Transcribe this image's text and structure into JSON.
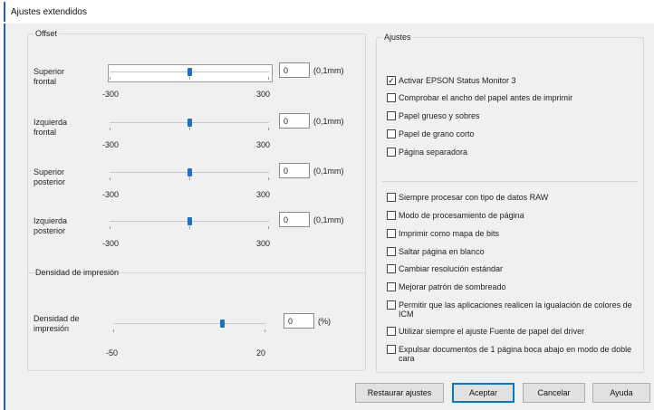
{
  "window": {
    "title": "Ajustes extendidos"
  },
  "offset": {
    "legend": "Offset",
    "sliders": [
      {
        "label_line1": "Superior",
        "label_line2": "frontal",
        "value": "0",
        "unit": "(0,1mm)",
        "min": "-300",
        "max": "300",
        "level": 0.5
      },
      {
        "label_line1": "Izquierda",
        "label_line2": "frontal",
        "value": "0",
        "unit": "(0,1mm)",
        "min": "-300",
        "max": "300",
        "level": 0.5
      },
      {
        "label_line1": "Superior",
        "label_line2": "posterior",
        "value": "0",
        "unit": "(0,1mm)",
        "min": "-300",
        "max": "300",
        "level": 0.5
      },
      {
        "label_line1": "Izquierda",
        "label_line2": "posterior",
        "value": "0",
        "unit": "(0,1mm)",
        "min": "-300",
        "max": "300",
        "level": 0.5
      }
    ]
  },
  "density": {
    "legend": "Densidad de impresión",
    "label_line1": "Densidad de",
    "label_line2": "impresión",
    "value": "0",
    "unit": "(%)",
    "min": "-50",
    "max": "20",
    "level": 0.714
  },
  "ajustes": {
    "legend": "Ajustes",
    "group1": [
      {
        "label": "Activar EPSON Status Monitor 3",
        "checked": true
      },
      {
        "label": "Comprobar el ancho del papel antes de imprimir",
        "checked": false
      },
      {
        "label": "Papel grueso y sobres",
        "checked": false
      },
      {
        "label": "Papel de grano corto",
        "checked": false
      },
      {
        "label": "Página separadora",
        "checked": false
      }
    ],
    "group2": [
      {
        "label": "Siempre procesar con tipo de datos RAW",
        "checked": false
      },
      {
        "label": "Modo de procesamiento de página",
        "checked": false
      },
      {
        "label": "Imprimir como mapa de bits",
        "checked": false
      },
      {
        "label": "Saltar página en blanco",
        "checked": false
      },
      {
        "label": "Cambiar resolución estándar",
        "checked": false
      },
      {
        "label": "Mejorar patrón de sombreado",
        "checked": false
      },
      {
        "label": "Permitir que las aplicaciones realicen la igualación de colores de ICM",
        "checked": false
      },
      {
        "label": "Utilizar siempre el ajuste Fuente de papel del driver",
        "checked": false
      },
      {
        "label": "Expulsar documentos de 1 página boca abajo en modo de doble cara",
        "checked": false
      }
    ]
  },
  "buttons": {
    "restore": "Restaurar ajustes",
    "ok": "Aceptar",
    "cancel": "Cancelar",
    "help": "Ayuda"
  },
  "colors": {
    "accent": "#1b6fd1",
    "frame": "#2a5fa8",
    "dialog_bg": "#f0f0f0"
  }
}
